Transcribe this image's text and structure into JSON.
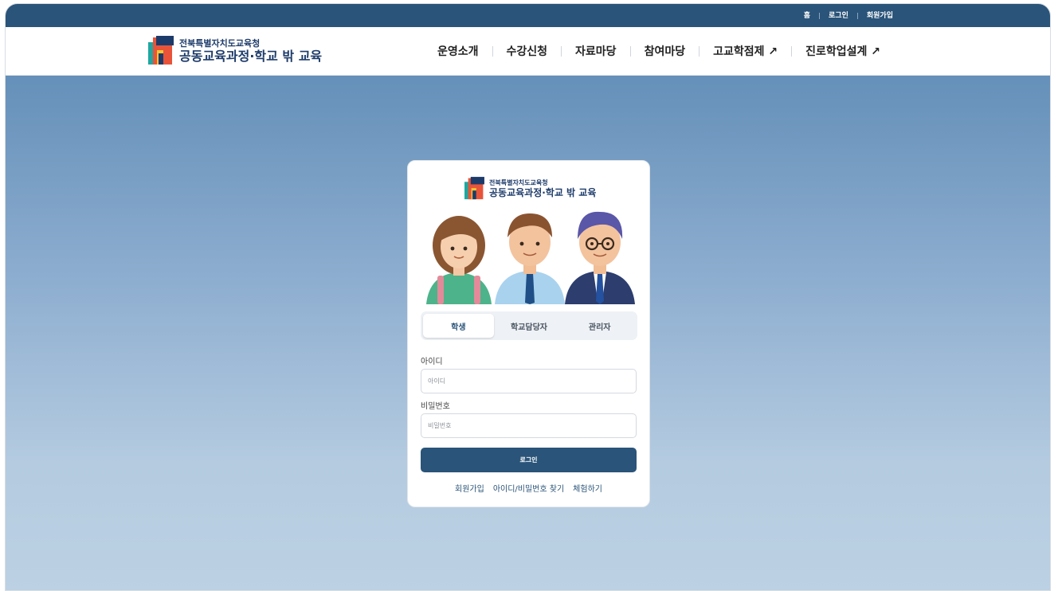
{
  "topbar": {
    "links": [
      "홈",
      "로그인",
      "회원가입"
    ]
  },
  "header": {
    "logo_small": "전북특별자치도교육청",
    "logo_big": "공동교육과정·학교 밖 교육",
    "menu": [
      "운영소개",
      "수강신청",
      "자료마당",
      "참여마당",
      "고교학점제 ↗",
      "진로학업설계 ↗"
    ]
  },
  "login": {
    "logo_small": "전북특별자치도교육청",
    "logo_big": "공동교육과정·학교 밖 교육",
    "tabs": [
      "학생",
      "학교담당자",
      "관리자"
    ],
    "active_tab": "학생",
    "id_label": "아이디",
    "id_placeholder": "아이디",
    "pw_label": "비밀번호",
    "pw_placeholder": "비밀번호",
    "submit_label": "로그인",
    "footer_links": [
      "회원가입",
      "아이디/비밀번호 찾기",
      "체험하기"
    ]
  },
  "colors": {
    "primary": "#2a5479",
    "logo_navy": "#1d3b6a",
    "logo_red": "#e8543a",
    "logo_teal": "#1fa7a0",
    "logo_yellow": "#f4c430"
  }
}
